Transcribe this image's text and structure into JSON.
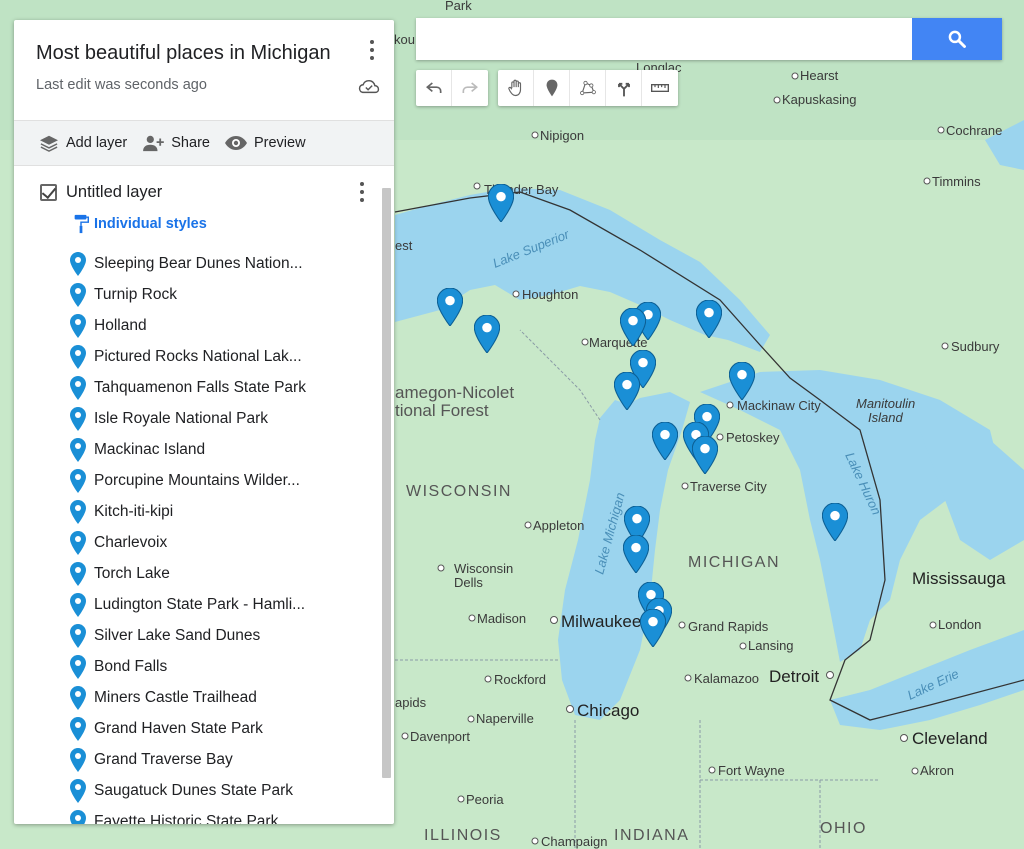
{
  "panel": {
    "title": "Most beautiful places in Michigan",
    "subtitle": "Last edit was seconds ago",
    "actions": {
      "add_layer": "Add layer",
      "share": "Share",
      "preview": "Preview"
    },
    "layer": {
      "name": "Untitled layer",
      "styles_label": "Individual styles",
      "places": [
        "Sleeping Bear Dunes Nation...",
        "Turnip Rock",
        "Holland",
        "Pictured Rocks National Lak...",
        "Tahquamenon Falls State Park",
        "Isle Royale National Park",
        "Mackinac Island",
        "Porcupine Mountains Wilder...",
        "Kitch-iti-kipi",
        "Charlevoix",
        "Torch Lake",
        "Ludington State Park - Hamli...",
        "Silver Lake Sand Dunes",
        "Bond Falls",
        "Miners Castle Trailhead",
        "Grand Haven State Park",
        "Grand Traverse Bay",
        "Saugatuck Dunes State Park",
        "Fayette Historic State Park"
      ]
    }
  },
  "search": {
    "placeholder": "",
    "icon": "search-icon"
  },
  "toolbar": [
    "undo-icon",
    "redo-icon",
    "hand-icon",
    "marker-icon",
    "draw-line-icon",
    "directions-icon",
    "ruler-icon"
  ],
  "map_labels": {
    "park": "Park",
    "hearst": "Hearst",
    "kapuskasing": "Kapuskasing",
    "nipigon": "Nipigon",
    "cochrane": "Cochrane",
    "thunder_bay": "Thunder Bay",
    "timmins": "Timmins",
    "lake_superior": "Lake Superior",
    "houghton": "Houghton",
    "marquette": "Marquette",
    "sudbury": "Sudbury",
    "chequamegon": "amegon-Nicolet",
    "national_forest": "tional Forest",
    "mackinaw_city": "Mackinaw City",
    "manitoulin": "Manitoulin",
    "island": "Island",
    "petoskey": "Petoskey",
    "lake_huron": "Lake Huron",
    "wisconsin": "WISCONSIN",
    "traverse_city": "Traverse City",
    "appleton": "Appleton",
    "lake_michigan": "Lake Michigan",
    "michigan": "MICHIGAN",
    "wisconsin_dells_1": "Wisconsin",
    "wisconsin_dells_2": "Dells",
    "mississauga": "Mississauga",
    "madison": "Madison",
    "milwaukee": "Milwaukee",
    "grand_rapids": "Grand Rapids",
    "london": "London",
    "lansing": "Lansing",
    "rockford": "Rockford",
    "kalamazoo": "Kalamazoo",
    "detroit": "Detroit",
    "lake_erie": "Lake Erie",
    "rapids": "apids",
    "chicago": "Chicago",
    "naperville": "Naperville",
    "davenport": "Davenport",
    "cleveland": "Cleveland",
    "fort_wayne": "Fort Wayne",
    "akron": "Akron",
    "peoria": "Peoria",
    "illinois": "ILLINOIS",
    "indiana": "INDIANA",
    "champaign": "Champaign",
    "ohio": "OHIO",
    "kou": "kou",
    "oglac": "Longlac",
    "est": "est"
  },
  "colors": {
    "land": "#c8e8c9",
    "water": "#9bd4ee",
    "pin": "#1a8fd6",
    "accent": "#1a73e8",
    "search_button": "#4285f4"
  }
}
